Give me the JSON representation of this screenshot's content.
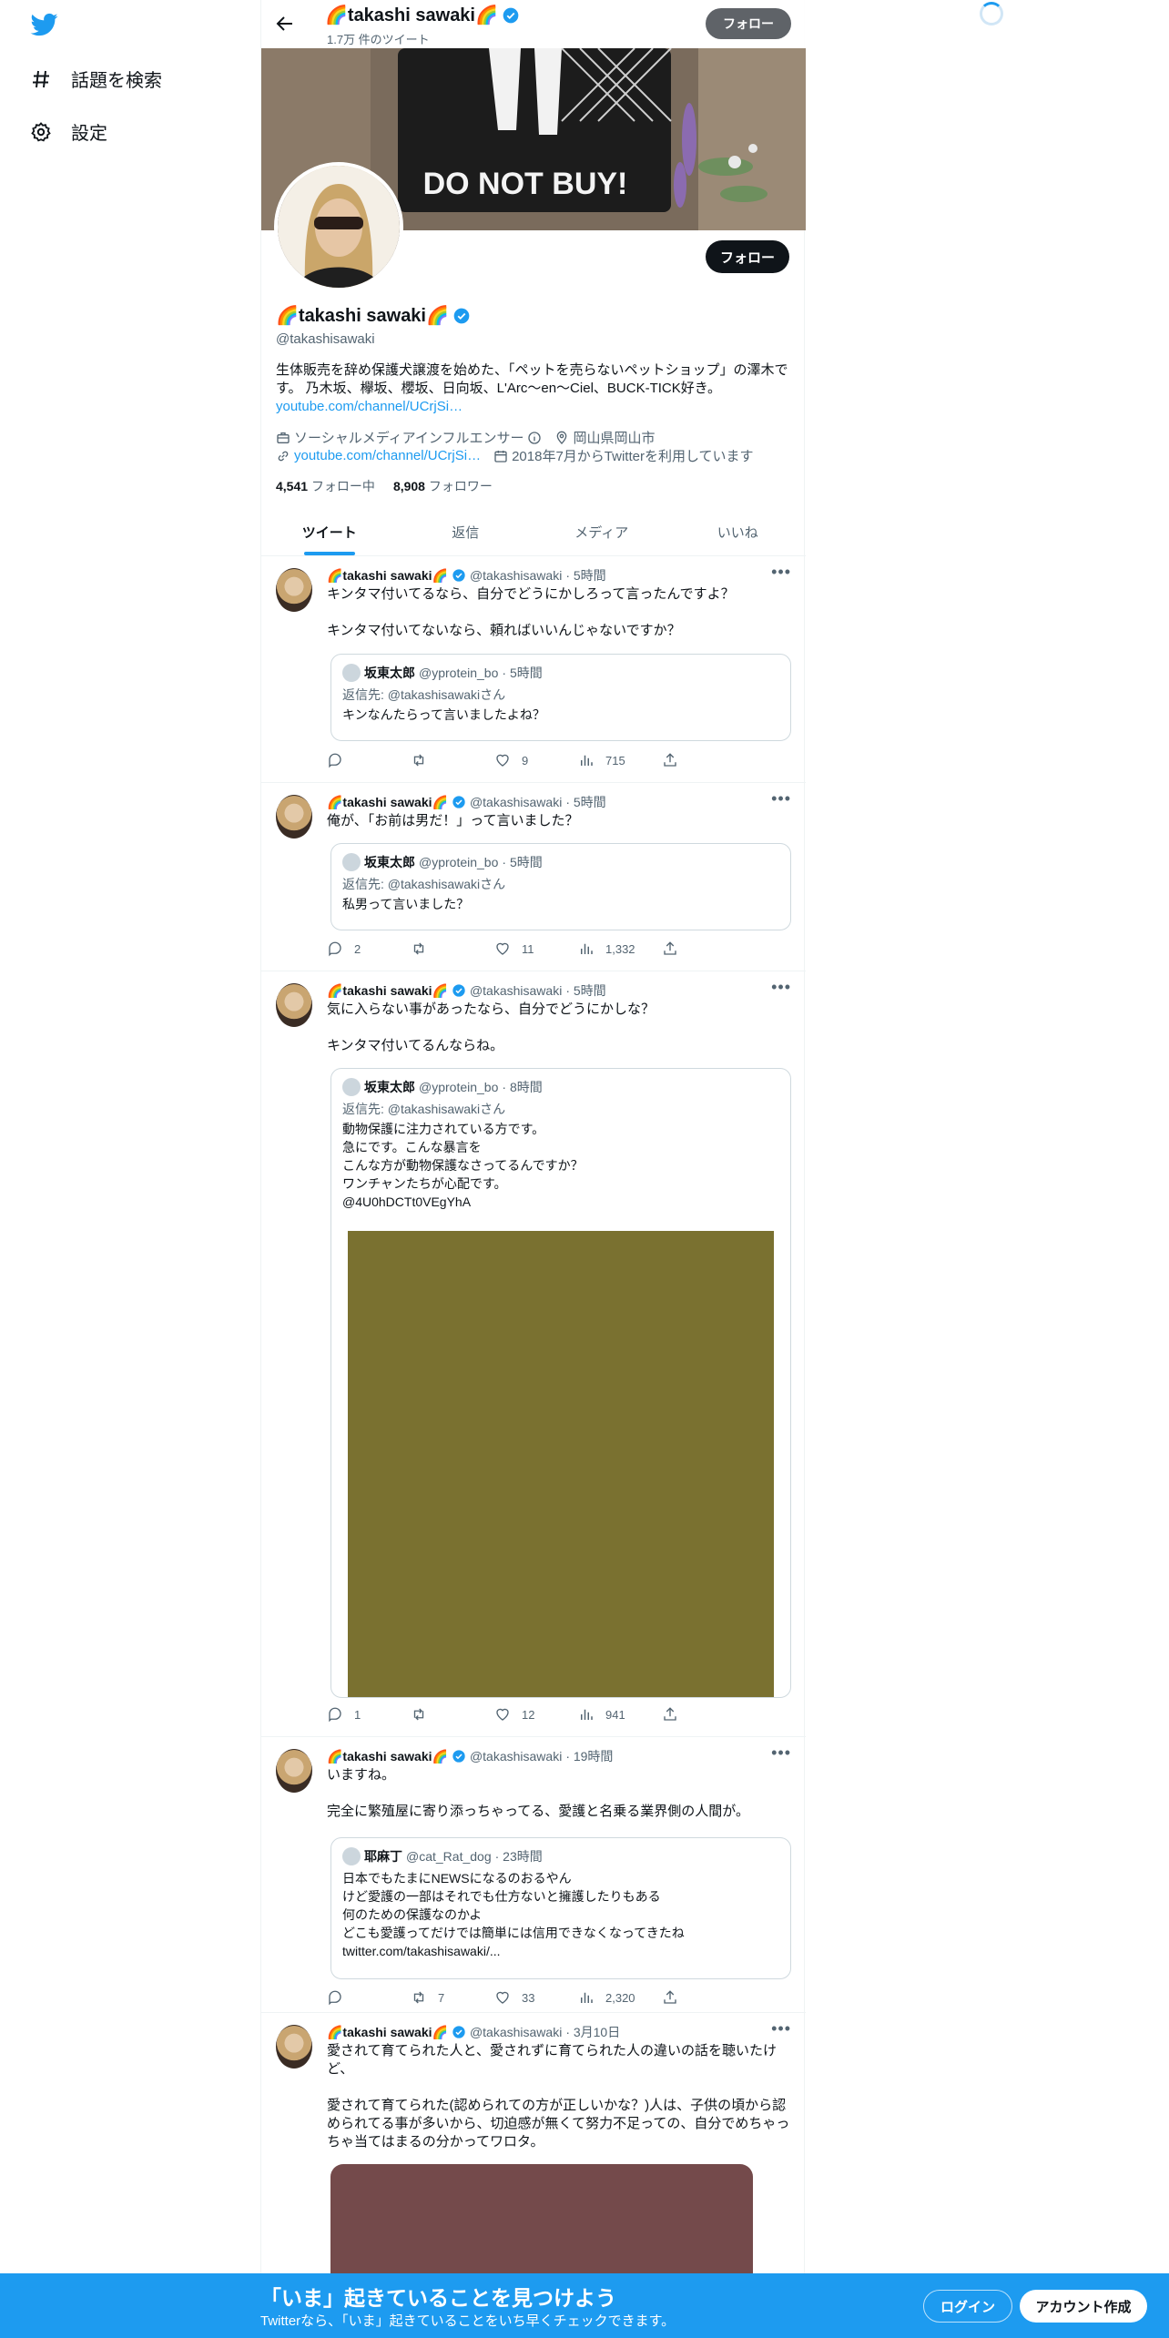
{
  "nav": {
    "explore": "話題を検索",
    "settings": "設定"
  },
  "topbar": {
    "name": "🌈takashi sawaki🌈",
    "tweet_count": "1.7万 件のツイート",
    "follow": "フォロー"
  },
  "banner": {
    "sign_text": "DO NOT BUY!"
  },
  "profile": {
    "name": "🌈takashi sawaki🌈",
    "handle": "@takashisawaki",
    "bio": "生体販売を辞め保護犬譲渡を始めた、「ペットを売らないペットショップ」の澤木です。 乃木坂、欅坂、櫻坂、日向坂、L'Arc〜en〜Ciel、BUCK-TICK好き。",
    "bio_link": "youtube.com/channel/UCrjSi…",
    "category": "ソーシャルメディアインフルエンサー",
    "location": "岡山県岡山市",
    "url": "youtube.com/channel/UCrjSi…",
    "joined": "2018年7月からTwitterを利用しています",
    "following_count": "4,541",
    "following_label": "フォロー中",
    "followers_count": "8,908",
    "followers_label": "フォロワー",
    "follow": "フォロー"
  },
  "tabs": [
    "ツイート",
    "返信",
    "メディア",
    "いいね"
  ],
  "tweets": [
    {
      "name": "🌈takashi sawaki🌈",
      "handle": "@takashisawaki",
      "time": "· 5時間",
      "text": "キンタマ付いてるなら、自分でどうにかしろって言ったんですよ？\n\nキンタマ付いてないなら、頼ればいいんじゃないですか？",
      "quote": {
        "name": "坂東太郎",
        "handle": "@yprotein_bo",
        "time": "· 5時間",
        "reply": "返信先: @takashisawakiさん",
        "text": "キンなんたらって言いましたよね？"
      },
      "reply_count": "",
      "retweet_count": "",
      "like_count": "9",
      "view_count": "715"
    },
    {
      "name": "🌈takashi sawaki🌈",
      "handle": "@takashisawaki",
      "time": "· 5時間",
      "text": "俺が、「お前は男だ！」って言いました？",
      "quote": {
        "name": "坂東太郎",
        "handle": "@yprotein_bo",
        "time": "· 5時間",
        "reply": "返信先: @takashisawakiさん",
        "text": "私男って言いました？"
      },
      "reply_count": "2",
      "retweet_count": "",
      "like_count": "11",
      "view_count": "1,332"
    },
    {
      "name": "🌈takashi sawaki🌈",
      "handle": "@takashisawaki",
      "time": "· 5時間",
      "text": "気に入らない事があったなら、自分でどうにかしな？\n\nキンタマ付いてるんならね。",
      "quote": {
        "name": "坂東太郎",
        "handle": "@yprotein_bo",
        "time": "· 8時間",
        "reply": "返信先: @takashisawakiさん",
        "text": "動物保護に注力されている方です。\n急にです。こんな暴言を\nこんな方が動物保護なさってるんですか？\nワンチャンたちが心配です。\n@4U0hDCTt0VEgYhA"
      },
      "reply_count": "1",
      "retweet_count": "",
      "like_count": "12",
      "view_count": "941",
      "media_color": "#7a7130"
    },
    {
      "name": "🌈takashi sawaki🌈",
      "handle": "@takashisawaki",
      "time": "· 19時間",
      "text": "いますね。\n\n完全に繁殖屋に寄り添っちゃってる、愛護と名乗る業界側の人間が。",
      "quote": {
        "name": "耶麻丁",
        "handle": "@cat_Rat_dog",
        "time": "· 23時間",
        "reply": "",
        "text": "日本でもたまにNEWSになるのおるやん\nけど愛護の一部はそれでも仕方ないと擁護したりもある\n何のための保護なのかよ\nどこも愛護ってだけでは簡単には信用できなくなってきたね\ntwitter.com/takashisawaki/..."
      },
      "reply_count": "",
      "retweet_count": "7",
      "like_count": "33",
      "view_count": "2,320"
    },
    {
      "name": "🌈takashi sawaki🌈",
      "handle": "@takashisawaki",
      "time": "· 3月10日",
      "text": "愛されて育てられた人と、愛されずに育てられた人の違いの話を聴いたけど、\n\n愛されて育てられた(認められての方が正しいかな？)人は、子供の頃から認められてる事が多いから、切迫感が無くて努力不足っての、自分でめちゃっちゃ当てはまるの分かってワロタ。",
      "media_color": "#744a4b"
    }
  ],
  "bottom_bar": {
    "title": "「いま」起きていることを見つけよう",
    "subtitle": "Twitterなら、「いま」起きていることをいち早くチェックできます。",
    "login": "ログイン",
    "signup": "アカウント作成"
  },
  "colors": {
    "accent": "#1d9bf0",
    "text": "#0f1419",
    "secondary": "#536471"
  }
}
